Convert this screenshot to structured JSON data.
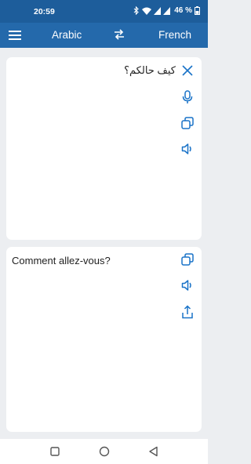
{
  "status_bar": {
    "time": "20:59",
    "battery_text": "46 %",
    "icons": [
      "bluetooth-icon",
      "wifi-icon",
      "signal-icon",
      "signal-icon",
      "battery-icon"
    ]
  },
  "app_bar": {
    "menu_icon": "menu-icon",
    "source_language": "Arabic",
    "swap_icon": "swap-icon",
    "target_language": "French",
    "background_color": "#2469ab"
  },
  "source_panel": {
    "text": "كيف حالكم؟",
    "actions": [
      "close-icon",
      "microphone-icon",
      "copy-icon",
      "speaker-icon"
    ]
  },
  "target_panel": {
    "text": "Comment allez-vous?",
    "actions": [
      "copy-icon",
      "speaker-icon",
      "share-icon"
    ]
  },
  "nav_bar": {
    "buttons": [
      "recents-button",
      "home-button",
      "back-button"
    ]
  },
  "colors": {
    "accent": "#1a73c8",
    "status_bar": "#1d5d9b",
    "background": "#eceef1"
  }
}
